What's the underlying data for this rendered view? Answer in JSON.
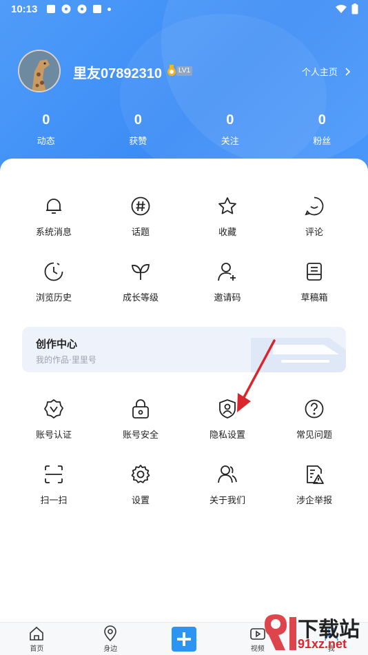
{
  "status_bar": {
    "time": "10:13"
  },
  "profile": {
    "username": "里友07892310",
    "level": "LV1",
    "homepage_link": "个人主页",
    "stats": [
      {
        "value": "0",
        "label": "动态"
      },
      {
        "value": "0",
        "label": "获赞"
      },
      {
        "value": "0",
        "label": "关注"
      },
      {
        "value": "0",
        "label": "粉丝"
      }
    ]
  },
  "menu_row1": [
    {
      "label": "系统消息",
      "icon": "bell-icon"
    },
    {
      "label": "话题",
      "icon": "hashtag-icon"
    },
    {
      "label": "收藏",
      "icon": "star-icon"
    },
    {
      "label": "评论",
      "icon": "comment-icon"
    }
  ],
  "menu_row2": [
    {
      "label": "浏览历史",
      "icon": "clock-icon"
    },
    {
      "label": "成长等级",
      "icon": "leaf-icon"
    },
    {
      "label": "邀请码",
      "icon": "add-user-icon"
    },
    {
      "label": "草稿箱",
      "icon": "draft-box-icon"
    }
  ],
  "creation_center": {
    "title": "创作中心",
    "subtitle": "我的作品·里里号"
  },
  "menu_row3": [
    {
      "label": "账号认证",
      "icon": "verified-badge-icon"
    },
    {
      "label": "账号安全",
      "icon": "lock-icon"
    },
    {
      "label": "隐私设置",
      "icon": "shield-user-icon"
    },
    {
      "label": "常见问题",
      "icon": "question-icon"
    }
  ],
  "menu_row4": [
    {
      "label": "扫一扫",
      "icon": "scan-icon"
    },
    {
      "label": "设置",
      "icon": "gear-icon"
    },
    {
      "label": "关于我们",
      "icon": "users-icon"
    },
    {
      "label": "涉企举报",
      "icon": "report-icon"
    }
  ],
  "tab_bar": [
    {
      "label": "首页",
      "icon": "home-icon"
    },
    {
      "label": "身边",
      "icon": "location-icon"
    },
    {
      "label": "",
      "icon": "plus-icon"
    },
    {
      "label": "视频",
      "icon": "video-icon"
    },
    {
      "label": "我",
      "icon": "profile-icon"
    }
  ],
  "watermark": {
    "line1": "下载站",
    "line2": "91xz.net"
  },
  "colors": {
    "header": "#3b8cf6",
    "accent": "#2c95f4",
    "annotation_arrow": "#d9252b"
  }
}
